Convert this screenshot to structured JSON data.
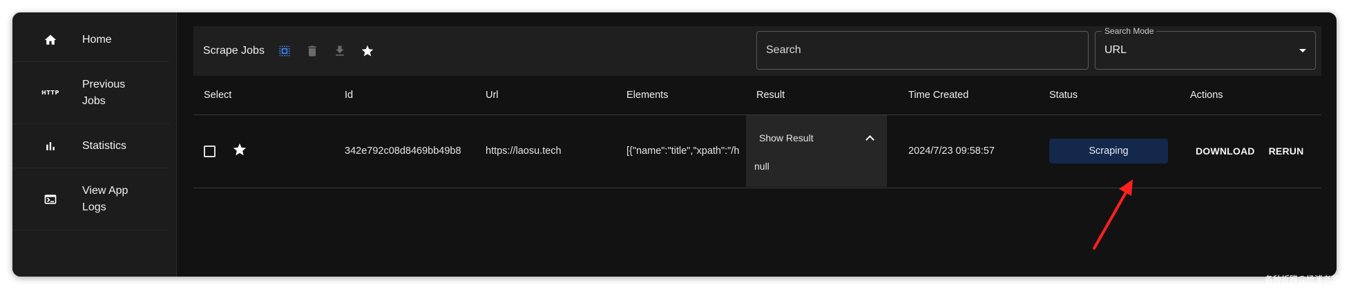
{
  "sidebar": {
    "items": [
      {
        "label": "Home",
        "icon": "home-icon"
      },
      {
        "label": "Previous Jobs",
        "icon": "http-icon",
        "icon_text": "HTTP"
      },
      {
        "label": "Statistics",
        "icon": "bar-chart-icon"
      },
      {
        "label": "View App Logs",
        "icon": "terminal-icon"
      }
    ]
  },
  "toolbar": {
    "title": "Scrape Jobs",
    "icons": [
      "select-all-icon",
      "delete-icon",
      "download-icon",
      "star-icon"
    ],
    "search_placeholder": "Search",
    "search_mode_label": "Search Mode",
    "search_mode_value": "URL"
  },
  "table": {
    "headers": [
      "Select",
      "Id",
      "Url",
      "Elements",
      "Result",
      "Time Created",
      "Status",
      "Actions"
    ],
    "rows": [
      {
        "id": "342e792c08d8469bb49b8",
        "url": "https://laosu.tech",
        "elements": "[{\"name\":\"title\",\"xpath\":\"/h",
        "result_toggle": "Show Result",
        "result_value": "null",
        "time_created": "2024/7/23 09:58:57",
        "status": "Scraping",
        "actions": [
          "DOWNLOAD",
          "RERUN"
        ]
      }
    ]
  },
  "colors": {
    "accent_blue": "#3d8bfd",
    "status_bg": "#13284a",
    "annotation_arrow": "#ff2020"
  },
  "watermark": "各种折腾@杨浦老苏"
}
